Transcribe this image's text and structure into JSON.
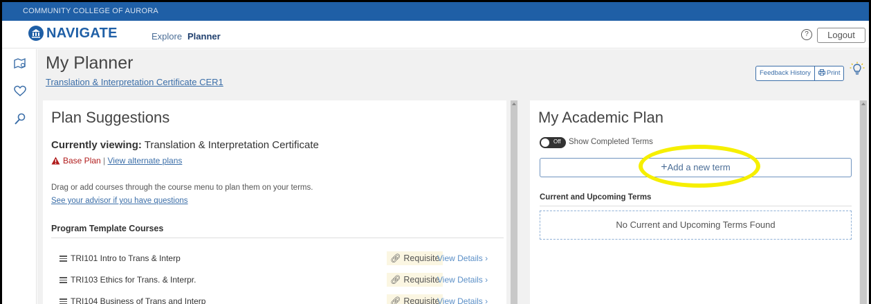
{
  "college": {
    "name": "COMMUNITY COLLEGE OF AURORA"
  },
  "nav": {
    "brand": "NAVIGATE",
    "explore": "Explore",
    "planner": "Planner",
    "help": "?",
    "logout": "Logout"
  },
  "rail": {
    "icons": [
      "map-people-icon",
      "heart-icon",
      "search-icon"
    ]
  },
  "header": {
    "title": "My Planner",
    "program_link": "Translation & Interpretation Certificate CER1",
    "feedback_label": "Feedback History",
    "print_label": "Print"
  },
  "suggestions": {
    "title": "Plan Suggestions",
    "viewing_label": "Currently viewing:",
    "viewing_value": "Translation & Interpretation Certificate",
    "base_plan": "Base Plan",
    "separator": "|",
    "alt_plans": "View alternate plans",
    "drag_text": "Drag or add courses through the course menu to plan them on your terms.",
    "advisor_link": "See your advisor if you have questions",
    "template_heading": "Program Template Courses",
    "requisite_label": "Requisite",
    "details_label": "View Details",
    "courses": [
      {
        "name": "TRI101 Intro to Trans & Interp"
      },
      {
        "name": "TRI103 Ethics for Trans. & Interpr."
      },
      {
        "name": "TRI104 Business of Trans and Interp"
      }
    ]
  },
  "academic": {
    "title": "My Academic Plan",
    "toggle_state": "Off",
    "show_completed": "Show Completed Terms",
    "add_term": "Add a new term",
    "current_heading": "Current and Upcoming Terms",
    "no_terms": "No Current and Upcoming Terms Found"
  },
  "colors": {
    "brand_blue": "#1f5fa6",
    "link_blue": "#3b6ea8",
    "warning_red": "#b11c1c",
    "highlight_yellow": "#f6ef00"
  }
}
